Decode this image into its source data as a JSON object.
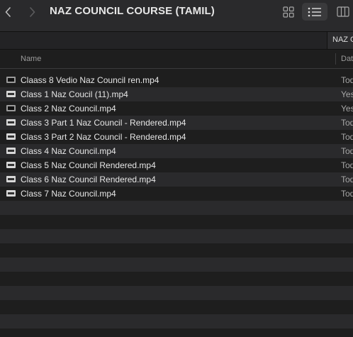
{
  "toolbar": {
    "title": "NAZ COUNCIL COURSE (TAMIL)",
    "back_icon": "chevron-left-icon",
    "forward_icon": "chevron-right-icon",
    "views": [
      {
        "name": "grid-view-icon",
        "active": false
      },
      {
        "name": "list-view-icon",
        "active": true
      },
      {
        "name": "column-view-icon",
        "active": false
      }
    ]
  },
  "tabs": [
    {
      "label": "NAZ C"
    }
  ],
  "columns": {
    "name": "Name",
    "date": "Dat"
  },
  "files": [
    {
      "name": "Claass 8 Vedio Naz Council ren.mp4",
      "date": "Tod",
      "icon": "video-file-icon"
    },
    {
      "name": "Class 1  Naz Coucil (11).mp4",
      "date": "Yes",
      "icon": "video-file-icon"
    },
    {
      "name": "Class 2 Naz Council.mp4",
      "date": "Yes",
      "icon": "video-file-icon"
    },
    {
      "name": "Class 3  Part 1 Naz Council - Rendered.mp4",
      "date": "Tod",
      "icon": "video-file-icon"
    },
    {
      "name": "Class 3 Part 2 Naz Council - Rendered.mp4",
      "date": "Tod",
      "icon": "video-file-icon"
    },
    {
      "name": "Class 4 Naz Council.mp4",
      "date": "Tod",
      "icon": "video-file-icon"
    },
    {
      "name": "Class 5 Naz Council Rendered.mp4",
      "date": "Tod",
      "icon": "video-file-icon"
    },
    {
      "name": "Class 6 Naz Council Rendered.mp4",
      "date": "Tod",
      "icon": "video-file-icon"
    },
    {
      "name": "Class 7 Naz Council.mp4",
      "date": "Tod",
      "icon": "video-file-icon"
    }
  ],
  "colors": {
    "background": "#1e1e1e",
    "row_stripe": "#2a2a2c",
    "toolbar": "#2a2a2c",
    "text": "#e6e6e6",
    "secondary_text": "#9a9a9a"
  }
}
